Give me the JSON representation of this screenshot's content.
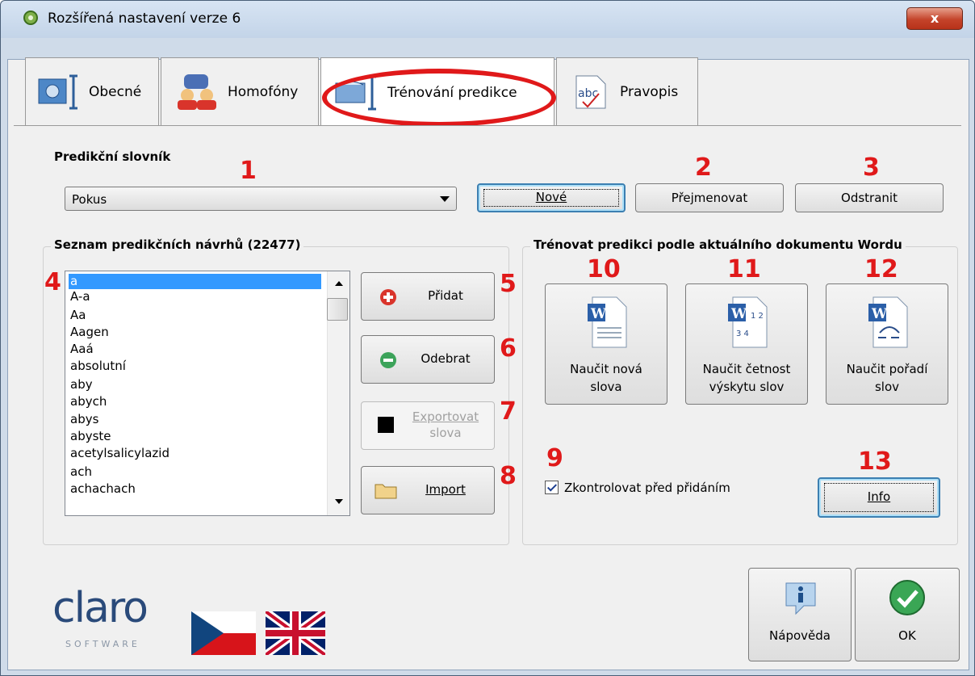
{
  "window": {
    "title": "Rozšířená nastavení verze 6",
    "close_label": "x"
  },
  "tabs": [
    {
      "label": "Obecné",
      "icon": "settings-icon"
    },
    {
      "label": "Homofóny",
      "icon": "people-icon"
    },
    {
      "label": "Trénování predikce",
      "icon": "book-icon",
      "active": true
    },
    {
      "label": "Pravopis",
      "icon": "spellcheck-icon"
    }
  ],
  "dictionary": {
    "label": "Predikční slovník",
    "selected": "Pokus",
    "new_label": "Nové",
    "rename_label": "Přejmenovat",
    "delete_label": "Odstranit"
  },
  "suggestions": {
    "title": "Seznam predikčních návrhů (22477)",
    "items": [
      "a",
      "A-a",
      "Aa",
      "Aagen",
      "Aaá",
      "absolutní",
      "aby",
      "abych",
      "abys",
      "abyste",
      "acetylsalicylazid",
      "ach",
      "achachach"
    ],
    "add_label": "Přidat",
    "remove_label": "Odebrat",
    "export_label_1": "Exportovat",
    "export_label_2": "slova",
    "import_label": "Import"
  },
  "training": {
    "title": "Trénovat predikci podle aktuálního dokumentu Wordu",
    "learn_new_1": "Naučit nová",
    "learn_new_2": "slova",
    "learn_freq_1": "Naučit četnost",
    "learn_freq_2": "výskytu slov",
    "learn_order_1": "Naučit pořadí",
    "learn_order_2": "slov",
    "check_label": "Zkontrolovat před přidáním",
    "check_checked": true,
    "info_label": "Info"
  },
  "footer": {
    "logo_text": "claro",
    "logo_sub": "SOFTWARE",
    "help_label": "Nápověda",
    "ok_label": "OK"
  },
  "annotations": [
    "1",
    "2",
    "3",
    "4",
    "5",
    "6",
    "7",
    "8",
    "9",
    "10",
    "11",
    "12",
    "13"
  ],
  "colors": {
    "annotation": "#e0191a",
    "accent": "#3399ff"
  }
}
